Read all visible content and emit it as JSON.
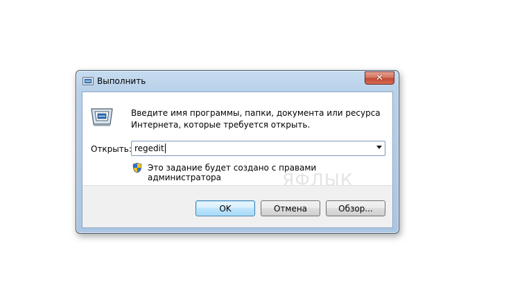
{
  "window": {
    "title": "Выполнить",
    "close_glyph": "✕",
    "icon": "run-icon"
  },
  "dialog": {
    "description": "Введите имя программы, папки, документа или ресурса Интернета, которые требуется открыть.",
    "open_label": "Открыть:",
    "open_value": "regedit",
    "admin_note": "Это задание будет создано с правами администратора",
    "shield_icon": "uac-shield-icon"
  },
  "buttons": {
    "ok": "OK",
    "cancel": "Отмена",
    "browse": "Обзор..."
  },
  "watermark": "ЯФЛЫК",
  "colors": {
    "titlebar": "#b9d1ea",
    "close_button": "#c24a35",
    "default_button_border": "#3c7fb1"
  }
}
